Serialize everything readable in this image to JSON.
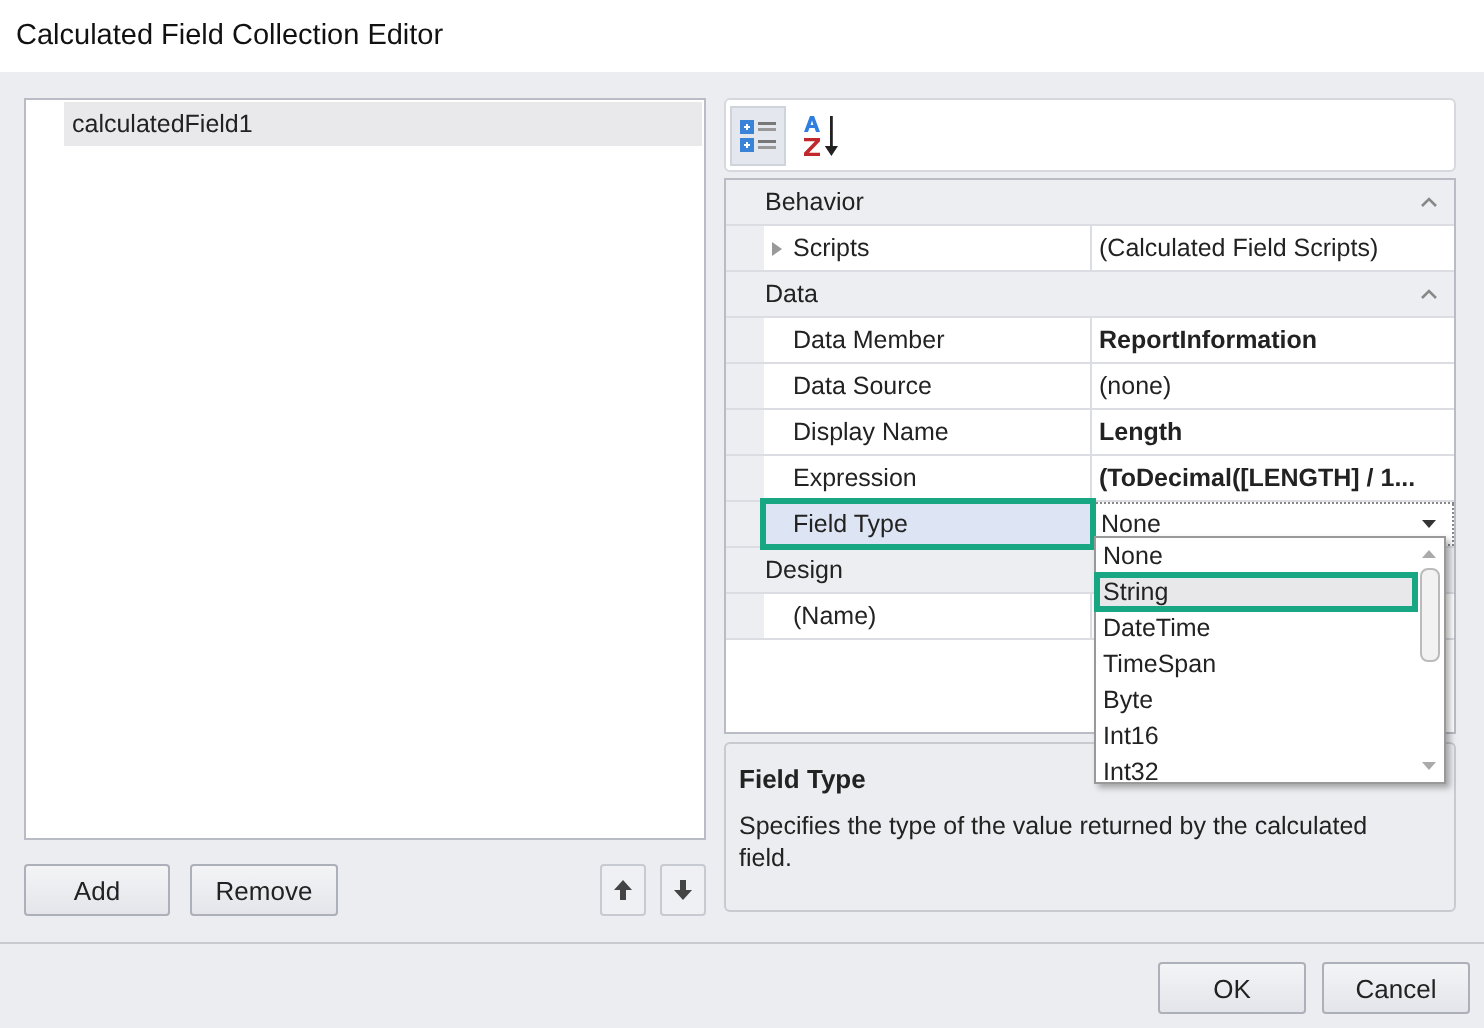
{
  "window": {
    "title": "Calculated Field Collection Editor"
  },
  "fields_list": {
    "items": [
      {
        "label": "calculatedField1",
        "selected": true
      }
    ]
  },
  "list_buttons": [
    {
      "label": "Add"
    },
    {
      "label": "Remove"
    }
  ],
  "move_buttons": [
    {
      "kind": "up"
    },
    {
      "kind": "down"
    }
  ],
  "toolbar": [
    {
      "kind": "categorized",
      "selected": true
    },
    {
      "kind": "alphabetical",
      "selected": false
    }
  ],
  "property_grid": {
    "categories": [
      {
        "name": "Behavior",
        "expanded": true,
        "properties": [
          {
            "name": "Scripts",
            "value": "(Calculated Field Scripts)",
            "bold": false,
            "expandable": true,
            "selected": false,
            "highlighted": false
          }
        ]
      },
      {
        "name": "Data",
        "expanded": true,
        "properties": [
          {
            "name": "Data Member",
            "value": "ReportInformation",
            "bold": true,
            "expandable": false,
            "selected": false,
            "highlighted": false
          },
          {
            "name": "Data Source",
            "value": "(none)",
            "bold": false,
            "expandable": false,
            "selected": false,
            "highlighted": false
          },
          {
            "name": "Display Name",
            "value": "Length",
            "bold": true,
            "expandable": false,
            "selected": false,
            "highlighted": false
          },
          {
            "name": "Expression",
            "value": "(ToDecimal([LENGTH] / 1...",
            "bold": true,
            "expandable": false,
            "selected": false,
            "highlighted": false
          },
          {
            "name": "Field Type",
            "value": "None",
            "bold": false,
            "expandable": false,
            "selected": true,
            "highlighted": true
          }
        ]
      },
      {
        "name": "Design",
        "expanded": true,
        "properties": [
          {
            "name": "(Name)",
            "expandable": false,
            "selected": false,
            "highlighted": false
          }
        ]
      }
    ]
  },
  "dropdown": {
    "options": [
      {
        "label": "None",
        "highlighted": false
      },
      {
        "label": "String",
        "highlighted": true
      },
      {
        "label": "DateTime",
        "highlighted": false
      },
      {
        "label": "TimeSpan",
        "highlighted": false
      },
      {
        "label": "Byte",
        "highlighted": false
      },
      {
        "label": "Int16",
        "highlighted": false
      },
      {
        "label": "Int32",
        "highlighted": false
      }
    ]
  },
  "description": {
    "title": "Field Type",
    "text": "Specifies the type of the value returned by the calculated field."
  },
  "dialog_buttons": [
    {
      "label": "OK"
    },
    {
      "label": "Cancel"
    }
  ]
}
